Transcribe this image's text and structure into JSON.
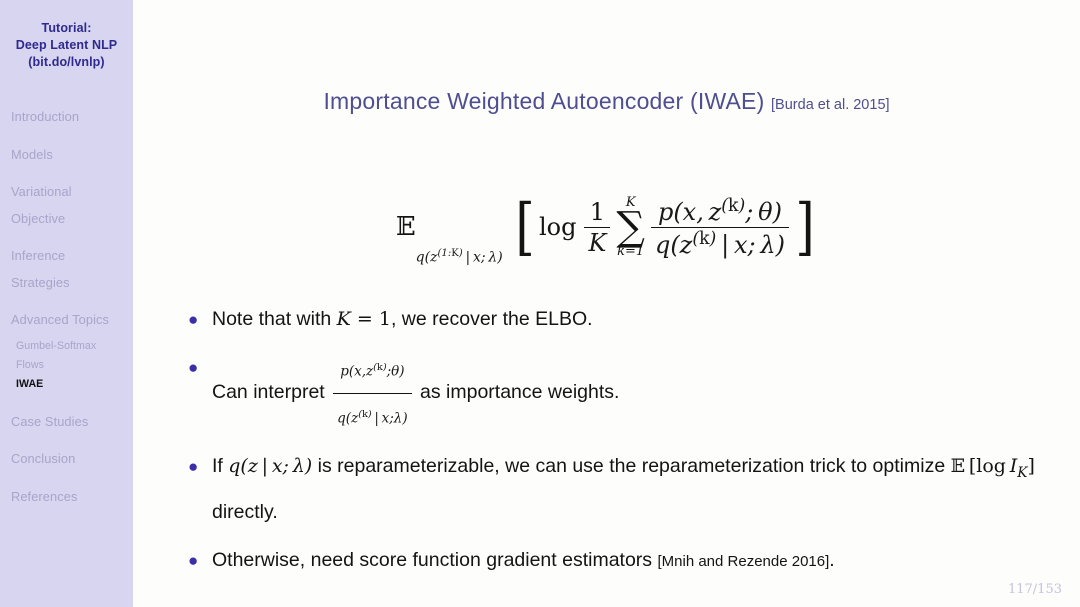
{
  "sidebar": {
    "title_lines": [
      "Tutorial:",
      "Deep Latent NLP",
      "(bit.do/lvnlp)"
    ],
    "sections": [
      {
        "label": "Introduction"
      },
      {
        "label": "Models"
      },
      {
        "label": "Variational"
      },
      {
        "label": "Objective"
      },
      {
        "label": "Inference"
      },
      {
        "label": "Strategies"
      },
      {
        "label": "Advanced Topics"
      }
    ],
    "subitems": [
      {
        "label": "Gumbel-Softmax",
        "current": false
      },
      {
        "label": "Flows",
        "current": false
      },
      {
        "label": "IWAE",
        "current": true
      }
    ],
    "sections_after": [
      {
        "label": "Case Studies"
      },
      {
        "label": "Conclusion"
      },
      {
        "label": "References"
      }
    ],
    "background_color": "#d7d5ef",
    "title_color": "#2e2a8f",
    "item_color": "#a7a5c9",
    "current_color": "#101010"
  },
  "slide": {
    "title": "Importance Weighted Autoencoder (IWAE)",
    "title_citation": "[Burda et al. 2015]",
    "title_color": "#4e4e91",
    "page_number": "117/153"
  },
  "equation": {
    "latex": "E_{q(z^{(1:K)} | x; \\lambda)} [ log (1/K) sum_{k=1}^{K} p(x, z^{(k)}; \\theta) / q(z^{(k)} | x; \\lambda) ]",
    "operator": "E",
    "subscript": "q(z^(1:K) | x; λ)",
    "log_word": "log",
    "frac_numerator": "1",
    "frac_denominator": "K",
    "sum_upper": "K",
    "sum_lower": "k=1",
    "sum_symbol": "∑",
    "inner_numerator": "p(x, z^(k); θ)",
    "inner_denominator": "q(z^(k) | x; λ)"
  },
  "bullets": [
    {
      "id": "bullet-elbo",
      "text_before": "Note that with ",
      "math": "K = 1",
      "text_after": ", we recover the ELBO."
    },
    {
      "id": "bullet-importance-weights",
      "text_before": "Can interpret ",
      "frac_num": "p(x,z^(k); θ)",
      "frac_den": "q(z^(k) | x; λ)",
      "text_after": " as importance weights."
    },
    {
      "id": "bullet-reparameterization",
      "text_before": "If ",
      "math": "q(z | x; λ)",
      "text_mid": " is reparameterizable, we can use the reparameterization trick to optimize ",
      "math2": "E [log I_K]",
      "text_after": " directly."
    },
    {
      "id": "bullet-score-function",
      "text_before": "Otherwise, need score function gradient estimators ",
      "citation": "[Mnih and Rezende 2016]",
      "text_after": "."
    }
  ],
  "colors": {
    "bullet_dot": "#3b2fa8",
    "page_background": "#fdfdfb",
    "body_text": "#141414",
    "page_number": "#c4c2dc"
  }
}
